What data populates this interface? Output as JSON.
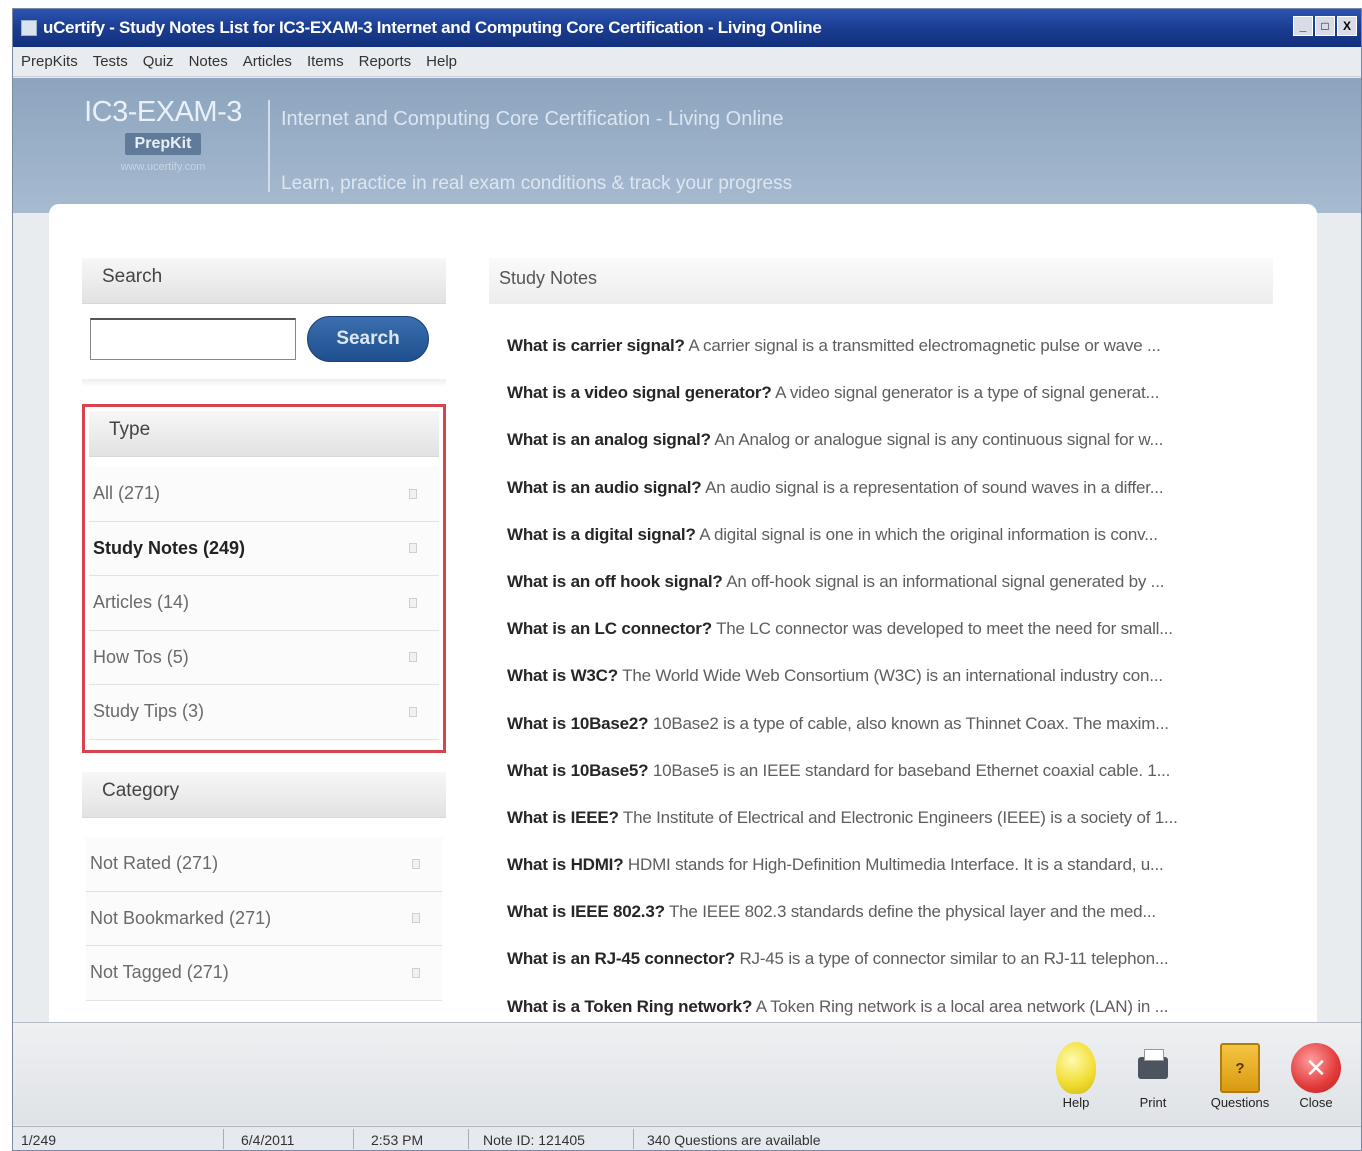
{
  "window": {
    "title": "uCertify - Study Notes List for IC3-EXAM-3 Internet and Computing Core Certification - Living Online",
    "controls": [
      "_",
      "□",
      "X"
    ]
  },
  "menu": [
    "PrepKits",
    "Tests",
    "Quiz",
    "Notes",
    "Articles",
    "Items",
    "Reports",
    "Help"
  ],
  "banner": {
    "logo_main": "IC3-EXAM-3",
    "logo_badge": "PrepKit",
    "logo_sub": "www.ucertify.com",
    "heading": "Internet and Computing Core Certification - Living Online",
    "tagline": "Learn, practice in real exam conditions & track your progress"
  },
  "search": {
    "header": "Search",
    "placeholder": "",
    "value": "",
    "button": "Search"
  },
  "type_filter": {
    "header": "Type",
    "items": [
      {
        "label": "All (271)"
      },
      {
        "label": "Study Notes (249)"
      },
      {
        "label": "Articles (14)"
      },
      {
        "label": "How Tos (5)"
      },
      {
        "label": "Study Tips (3)"
      }
    ],
    "active_index": 1
  },
  "category_filter": {
    "header": "Category",
    "items": [
      {
        "label": "Not Rated (271)"
      },
      {
        "label": "Not Bookmarked (271)"
      },
      {
        "label": "Not Tagged (271)"
      }
    ]
  },
  "notes": {
    "header": "Study Notes",
    "items": [
      {
        "q": "What is carrier signal?",
        "a": " A carrier signal is a transmitted electromagnetic pulse or wave ..."
      },
      {
        "q": "What is a video signal generator?",
        "a": " A video signal generator is a type of signal generat..."
      },
      {
        "q": "What is an analog signal?",
        "a": " An Analog or analogue signal is any continuous signal for w..."
      },
      {
        "q": "What is an audio signal?",
        "a": " An audio signal is a representation of sound waves in a differ..."
      },
      {
        "q": "What is a digital signal?",
        "a": " A digital signal is one in which the original information is conv..."
      },
      {
        "q": "What is an off hook signal?",
        "a": " An off-hook signal is an informational signal generated by ..."
      },
      {
        "q": "What is an LC connector?",
        "a": " The LC connector was developed to meet the need for small..."
      },
      {
        "q": "What is W3C?",
        "a": " The World Wide Web Consortium (W3C) is an international industry con..."
      },
      {
        "q": "What is 10Base2?",
        "a": " 10Base2 is a type of cable, also known as Thinnet Coax. The maxim..."
      },
      {
        "q": "What is 10Base5?",
        "a": " 10Base5 is an IEEE standard for baseband Ethernet coaxial cable. 1..."
      },
      {
        "q": "What is IEEE?",
        "a": " The Institute of Electrical and Electronic Engineers (IEEE) is a society of 1..."
      },
      {
        "q": "What is HDMI?",
        "a": " HDMI stands for High-Definition Multimedia Interface. It is a standard, u..."
      },
      {
        "q": "What is IEEE 802.3?",
        "a": " The IEEE 802.3 standards define the physical layer and the med..."
      },
      {
        "q": "What is an RJ-45 connector?",
        "a": " RJ-45 is a type of connector similar to an RJ-11 telephon..."
      },
      {
        "q": "What is a Token Ring network?",
        "a": " A Token Ring network is a local area network (LAN) in ..."
      }
    ]
  },
  "toolbar": {
    "help": "Help",
    "print": "Print",
    "questions": "Questions",
    "close": "Close"
  },
  "status": {
    "index": "1/249",
    "date": "6/4/2011",
    "time": "2:53 PM",
    "note_id": "Note ID: 121405",
    "questions": "340 Questions are available"
  }
}
